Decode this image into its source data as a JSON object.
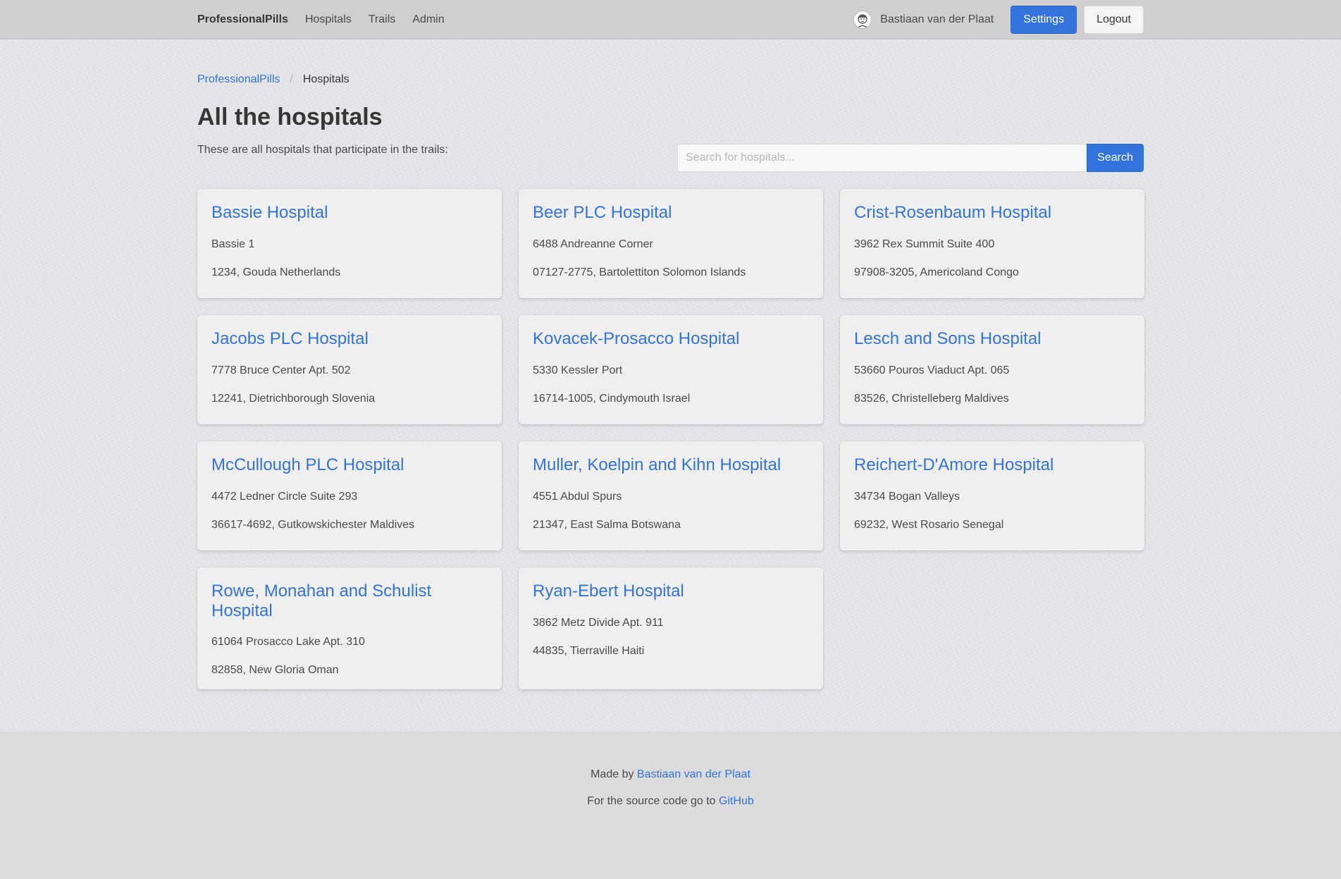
{
  "nav": {
    "brand": "ProfessionalPills",
    "links": [
      "Hospitals",
      "Trails",
      "Admin"
    ],
    "user_name": "Bastiaan van der Plaat",
    "settings_label": "Settings",
    "logout_label": "Logout"
  },
  "breadcrumb": {
    "root": "ProfessionalPills",
    "separator": "/",
    "current": "Hospitals"
  },
  "page": {
    "title": "All the hospitals",
    "intro": "These are all hospitals that participate in the trails:"
  },
  "search": {
    "placeholder": "Search for hospitals...",
    "button_label": "Search"
  },
  "hospitals": [
    {
      "name": "Bassie Hospital",
      "street": "Bassie 1",
      "city": "1234, Gouda Netherlands"
    },
    {
      "name": "Beer PLC Hospital",
      "street": "6488 Andreanne Corner",
      "city": "07127-2775, Bartolettiton Solomon Islands"
    },
    {
      "name": "Crist-Rosenbaum Hospital",
      "street": "3962 Rex Summit Suite 400",
      "city": "97908-3205, Americoland Congo"
    },
    {
      "name": "Jacobs PLC Hospital",
      "street": "7778 Bruce Center Apt. 502",
      "city": "12241, Dietrichborough Slovenia"
    },
    {
      "name": "Kovacek-Prosacco Hospital",
      "street": "5330 Kessler Port",
      "city": "16714-1005, Cindymouth Israel"
    },
    {
      "name": "Lesch and Sons Hospital",
      "street": "53660 Pouros Viaduct Apt. 065",
      "city": "83526, Christelleberg Maldives"
    },
    {
      "name": "McCullough PLC Hospital",
      "street": "4472 Ledner Circle Suite 293",
      "city": "36617-4692, Gutkowskichester Maldives"
    },
    {
      "name": "Muller, Koelpin and Kihn Hospital",
      "street": "4551 Abdul Spurs",
      "city": "21347, East Salma Botswana"
    },
    {
      "name": "Reichert-D'Amore Hospital",
      "street": "34734 Bogan Valleys",
      "city": "69232, West Rosario Senegal"
    },
    {
      "name": "Rowe, Monahan and Schulist Hospital",
      "street": "61064 Prosacco Lake Apt. 310",
      "city": "82858, New Gloria Oman"
    },
    {
      "name": "Ryan-Ebert Hospital",
      "street": "3862 Metz Divide Apt. 911",
      "city": "44835, Tierraville Haiti"
    }
  ],
  "footer": {
    "made_by_prefix": "Made by ",
    "made_by_link": "Bastiaan van der Plaat",
    "source_prefix": "For the source code go to ",
    "source_link": "GitHub"
  },
  "colors": {
    "accent": "#3273dc",
    "navbar": "#cfcfcf",
    "card": "#efefef",
    "footer": "#dcdcdc"
  }
}
